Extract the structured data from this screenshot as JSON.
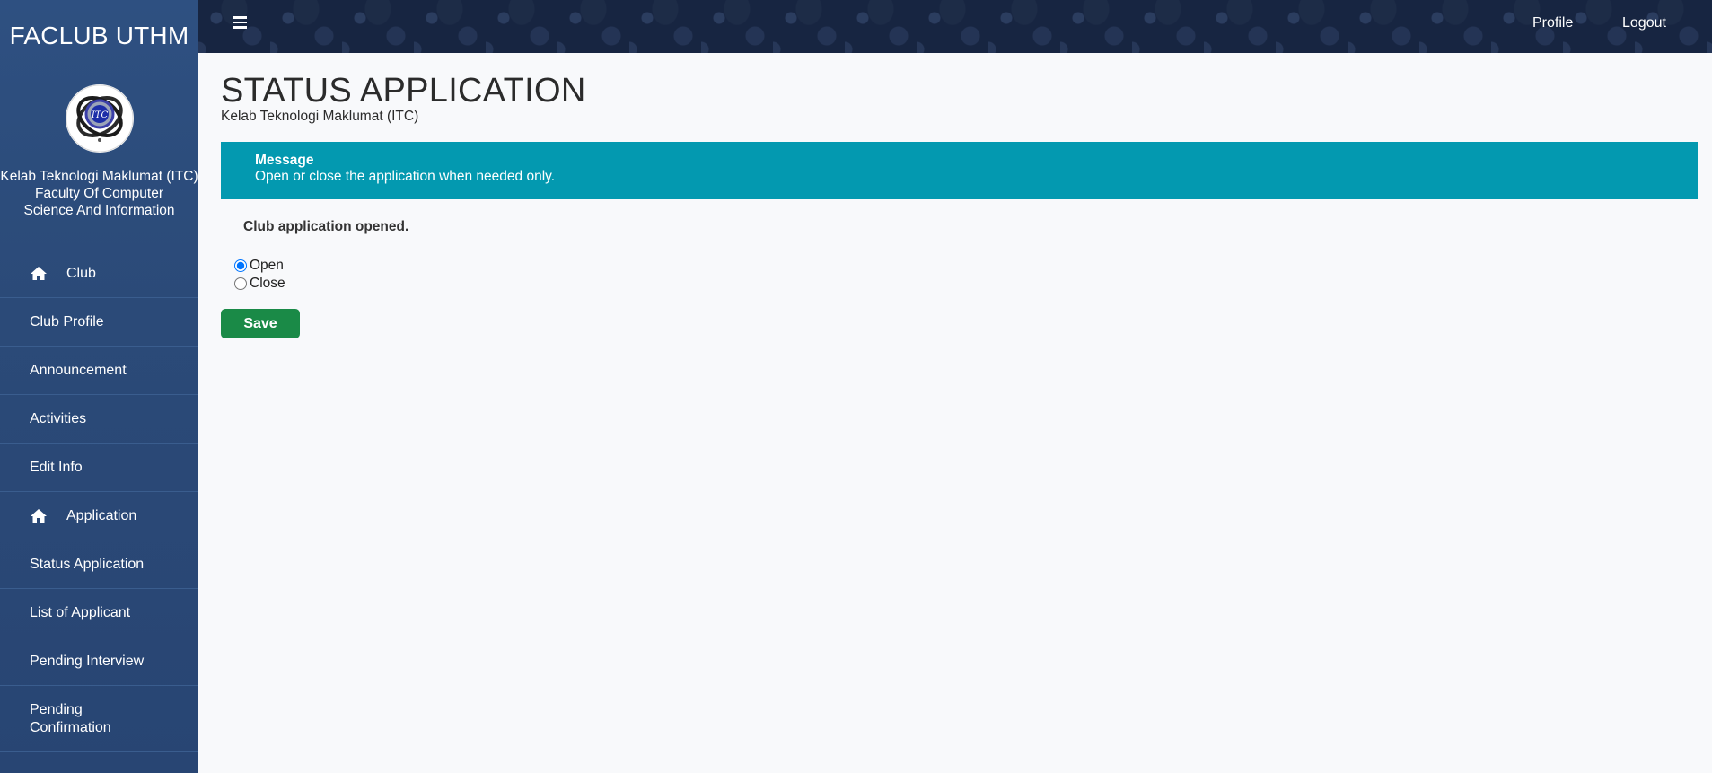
{
  "sidebar": {
    "brand": "FACLUB UTHM",
    "club_name": "Kelab Teknologi Maklumat (ITC)",
    "faculty": "Faculty Of Computer Science And Information",
    "items": [
      {
        "label": "Club",
        "icon": "home-icon"
      },
      {
        "label": "Club Profile"
      },
      {
        "label": "Announcement"
      },
      {
        "label": "Activities"
      },
      {
        "label": "Edit Info"
      },
      {
        "label": "Application",
        "icon": "home-icon"
      },
      {
        "label": "Status Application"
      },
      {
        "label": "List of Applicant"
      },
      {
        "label": "Pending Interview"
      },
      {
        "label": "Pending Confirmation"
      }
    ]
  },
  "topbar": {
    "menu_icon": "hamburger-icon",
    "profile_label": "Profile",
    "logout_label": "Logout"
  },
  "main": {
    "title": "STATUS APPLICATION",
    "subtitle": "Kelab Teknologi Maklumat (ITC)",
    "message": {
      "title": "Message",
      "text": "Open or close the application when needed only."
    },
    "status_text": "Club application opened.",
    "options": [
      {
        "label": "Open",
        "checked": true
      },
      {
        "label": "Close",
        "checked": false
      }
    ],
    "save_label": "Save"
  },
  "colors": {
    "sidebar": "#2b4a78",
    "message_bg": "#0399b0",
    "save_button": "#1a8a47",
    "topbar": "#172541"
  }
}
